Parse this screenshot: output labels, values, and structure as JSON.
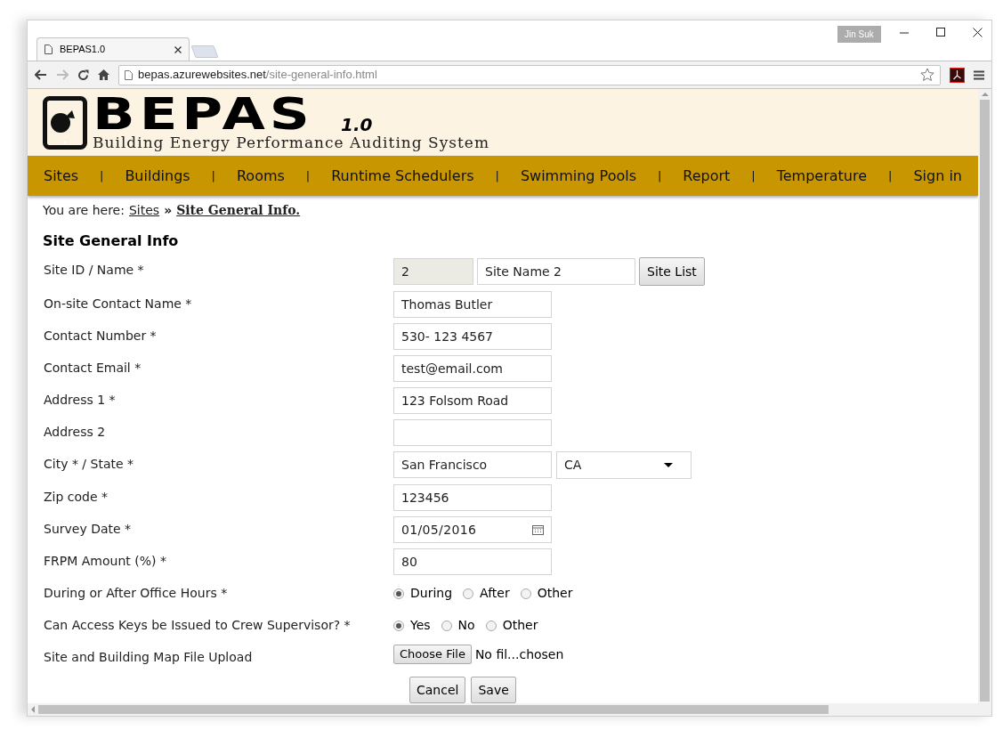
{
  "browser": {
    "tab_title": "BEPAS1.0",
    "profile": "Jin Suk",
    "url_host": "bepas.azurewebsites.net",
    "url_path": "/site-general-info.html"
  },
  "logo": {
    "title": "BEPAS",
    "version": "1.0",
    "subtitle": "Building Energy Performance Auditing System"
  },
  "nav": [
    "Sites",
    "Buildings",
    "Rooms",
    "Runtime Schedulers",
    "Swimming Pools",
    "Report",
    "Temperature",
    "Sign in"
  ],
  "nav_separator": "|",
  "breadcrumb": {
    "prefix": "You are here:",
    "link": "Sites",
    "separator": "»",
    "current": "Site General Info."
  },
  "heading": "Site General Info",
  "rows": [
    {
      "kind": "site",
      "label": "Site ID / Name *",
      "id_value": "2",
      "name_value": "Site Name 2",
      "button": "Site List"
    },
    {
      "kind": "text",
      "label": "On-site Contact Name *",
      "value": "Thomas Butler"
    },
    {
      "kind": "text",
      "label": "Contact Number *",
      "value": "530- 123 4567"
    },
    {
      "kind": "text",
      "label": "Contact Email *",
      "value": "test@email.com"
    },
    {
      "kind": "text",
      "label": "Address 1 *",
      "value": "123 Folsom Road"
    },
    {
      "kind": "text",
      "label": "Address 2",
      "value": ""
    },
    {
      "kind": "city",
      "label": "City * / State *",
      "value": "San Francisco",
      "state": "CA"
    },
    {
      "kind": "text",
      "label": "Zip code *",
      "value": "123456"
    },
    {
      "kind": "date",
      "label": "Survey Date *",
      "value": "01/05/2016"
    },
    {
      "kind": "text",
      "label": "FRPM Amount (%) *",
      "value": "80"
    },
    {
      "kind": "radio",
      "label": "During or After Office Hours *",
      "options": [
        {
          "label": "During",
          "selected": true
        },
        {
          "label": "After",
          "selected": false
        },
        {
          "label": "Other",
          "selected": false
        }
      ]
    },
    {
      "kind": "radio",
      "label": "Can Access Keys be Issued to Crew Supervisor? *",
      "options": [
        {
          "label": "Yes",
          "selected": true
        },
        {
          "label": "No",
          "selected": false
        },
        {
          "label": "Other",
          "selected": false
        }
      ]
    },
    {
      "kind": "file",
      "label": "Site and Building Map File Upload",
      "button": "Choose File",
      "status": "No fil...chosen"
    }
  ],
  "actions": [
    "Cancel",
    "Save"
  ]
}
